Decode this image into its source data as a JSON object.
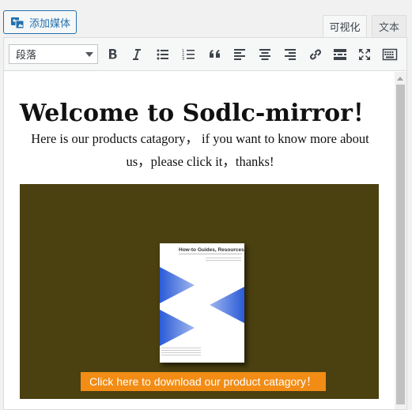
{
  "media_button": {
    "label": "添加媒体",
    "icon": "add-media-icon"
  },
  "tabs": [
    {
      "label": "可视化",
      "active": true
    },
    {
      "label": "文本",
      "active": false
    }
  ],
  "toolbar": {
    "format_select": "段落",
    "buttons": [
      {
        "name": "bold",
        "icon": "bold-icon"
      },
      {
        "name": "italic",
        "icon": "italic-icon"
      },
      {
        "name": "bulleted-list",
        "icon": "bulleted-list-icon"
      },
      {
        "name": "numbered-list",
        "icon": "numbered-list-icon"
      },
      {
        "name": "blockquote",
        "icon": "blockquote-icon"
      },
      {
        "name": "align-left",
        "icon": "align-left-icon"
      },
      {
        "name": "align-center",
        "icon": "align-center-icon"
      },
      {
        "name": "align-right",
        "icon": "align-right-icon"
      },
      {
        "name": "insert-link",
        "icon": "link-icon"
      },
      {
        "name": "read-more",
        "icon": "read-more-icon"
      },
      {
        "name": "fullscreen",
        "icon": "fullscreen-icon"
      },
      {
        "name": "toolbar-toggle",
        "icon": "keyboard-icon"
      }
    ]
  },
  "content": {
    "heading": "Welcome to Sodlc-mirror！",
    "intro": "Here is our products catagory，  if you want to know more about us，please click it，thanks!",
    "banner": {
      "background_color": "#4b4010",
      "brochure_title": "How-to Guides, Resources",
      "cta_label": "Click here to download our product catagory！",
      "cta_color": "#f28c14"
    }
  }
}
